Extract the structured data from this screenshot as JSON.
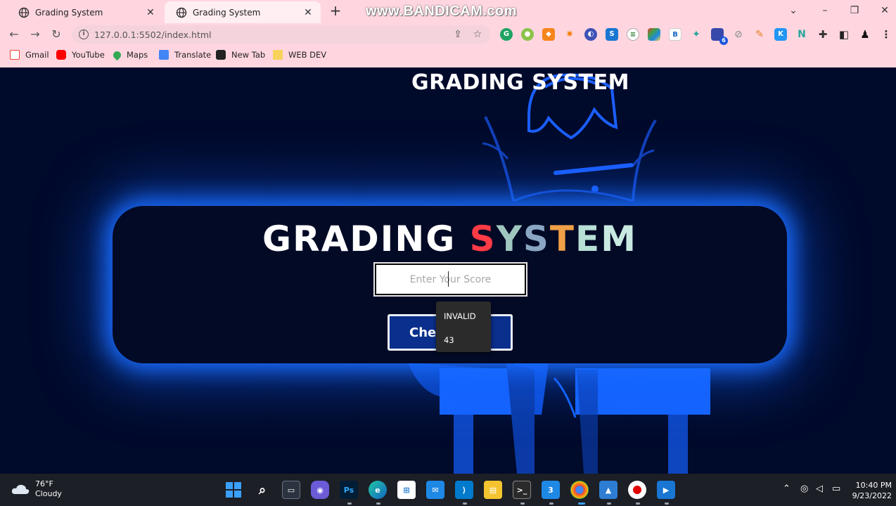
{
  "browser": {
    "tabs": [
      {
        "label": "Grading System",
        "active": false
      },
      {
        "label": "Grading System",
        "active": true
      }
    ],
    "recorder_watermark": "www.BANDICAM.com",
    "address_bar": {
      "url": "127.0.0.1:5502/index.html"
    },
    "bookmarks": [
      {
        "label": "Gmail",
        "icon": "gmail-icon",
        "color": "#ea4335"
      },
      {
        "label": "YouTube",
        "icon": "youtube-icon",
        "color": "#ff0000"
      },
      {
        "label": "Maps",
        "icon": "maps-icon",
        "color": "#34a853"
      },
      {
        "label": "Translate",
        "icon": "translate-icon",
        "color": "#4285f4"
      },
      {
        "label": "New Tab",
        "icon": "newtab-icon",
        "color": "#222222"
      },
      {
        "label": "WEB DEV",
        "icon": "folder-icon",
        "color": "#f7d35b"
      }
    ],
    "extensions_badge": "6"
  },
  "page": {
    "header": "GRADING SYSTEM",
    "card": {
      "title_part1": "GRADING ",
      "title_letters": [
        "S",
        "Y",
        "S",
        "T",
        "E",
        "M"
      ],
      "input_placeholder": "Enter Your Score",
      "button_label": "Check",
      "autocomplete_options": [
        "INVALID",
        "43"
      ]
    },
    "colors": {
      "background": "#000a2b",
      "glow": "#1a6dff",
      "button": "#0a2f8c"
    }
  },
  "taskbar": {
    "weather": {
      "temp": "76°F",
      "condition": "Cloudy"
    },
    "clock": {
      "time": "10:40 PM",
      "date": "9/23/2022"
    }
  }
}
